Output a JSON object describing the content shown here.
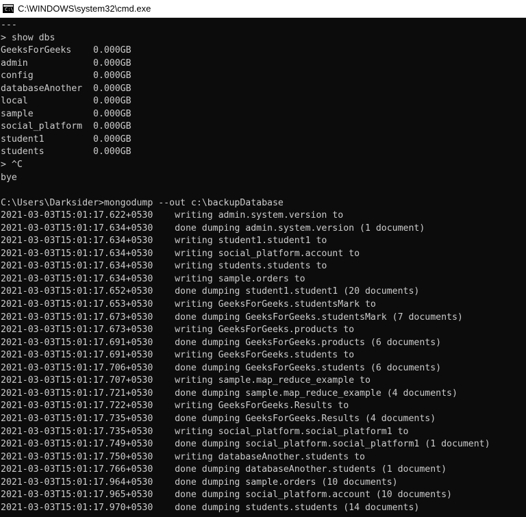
{
  "window": {
    "title": "C:\\WINDOWS\\system32\\cmd.exe",
    "icon": "command-prompt-icon",
    "prompt_glyph": "C:\\",
    "colors": {
      "background": "#0c0c0c",
      "text": "#cccccc",
      "titlebar": "#ffffff"
    }
  },
  "console": {
    "lines": [
      "---",
      "> show dbs",
      "GeeksForGeeks    0.000GB",
      "admin            0.000GB",
      "config           0.000GB",
      "databaseAnother  0.000GB",
      "local            0.000GB",
      "sample           0.000GB",
      "social_platform  0.000GB",
      "student1         0.000GB",
      "students         0.000GB",
      "> ^C",
      "bye",
      "",
      "C:\\Users\\Darksider>mongodump --out c:\\backupDatabase",
      "2021-03-03T15:01:17.622+0530    writing admin.system.version to",
      "2021-03-03T15:01:17.634+0530    done dumping admin.system.version (1 document)",
      "2021-03-03T15:01:17.634+0530    writing student1.student1 to",
      "2021-03-03T15:01:17.634+0530    writing social_platform.account to",
      "2021-03-03T15:01:17.634+0530    writing students.students to",
      "2021-03-03T15:01:17.634+0530    writing sample.orders to",
      "2021-03-03T15:01:17.652+0530    done dumping student1.student1 (20 documents)",
      "2021-03-03T15:01:17.653+0530    writing GeeksForGeeks.studentsMark to",
      "2021-03-03T15:01:17.673+0530    done dumping GeeksForGeeks.studentsMark (7 documents)",
      "2021-03-03T15:01:17.673+0530    writing GeeksForGeeks.products to",
      "2021-03-03T15:01:17.691+0530    done dumping GeeksForGeeks.products (6 documents)",
      "2021-03-03T15:01:17.691+0530    writing GeeksForGeeks.students to",
      "2021-03-03T15:01:17.706+0530    done dumping GeeksForGeeks.students (6 documents)",
      "2021-03-03T15:01:17.707+0530    writing sample.map_reduce_example to",
      "2021-03-03T15:01:17.721+0530    done dumping sample.map_reduce_example (4 documents)",
      "2021-03-03T15:01:17.722+0530    writing GeeksForGeeks.Results to",
      "2021-03-03T15:01:17.735+0530    done dumping GeeksForGeeks.Results (4 documents)",
      "2021-03-03T15:01:17.735+0530    writing social_platform.social_platform1 to",
      "2021-03-03T15:01:17.749+0530    done dumping social_platform.social_platform1 (1 document)",
      "2021-03-03T15:01:17.750+0530    writing databaseAnother.students to",
      "2021-03-03T15:01:17.766+0530    done dumping databaseAnother.students (1 document)",
      "2021-03-03T15:01:17.964+0530    done dumping sample.orders (10 documents)",
      "2021-03-03T15:01:17.965+0530    done dumping social_platform.account (10 documents)",
      "2021-03-03T15:01:17.970+0530    done dumping students.students (14 documents)"
    ]
  }
}
